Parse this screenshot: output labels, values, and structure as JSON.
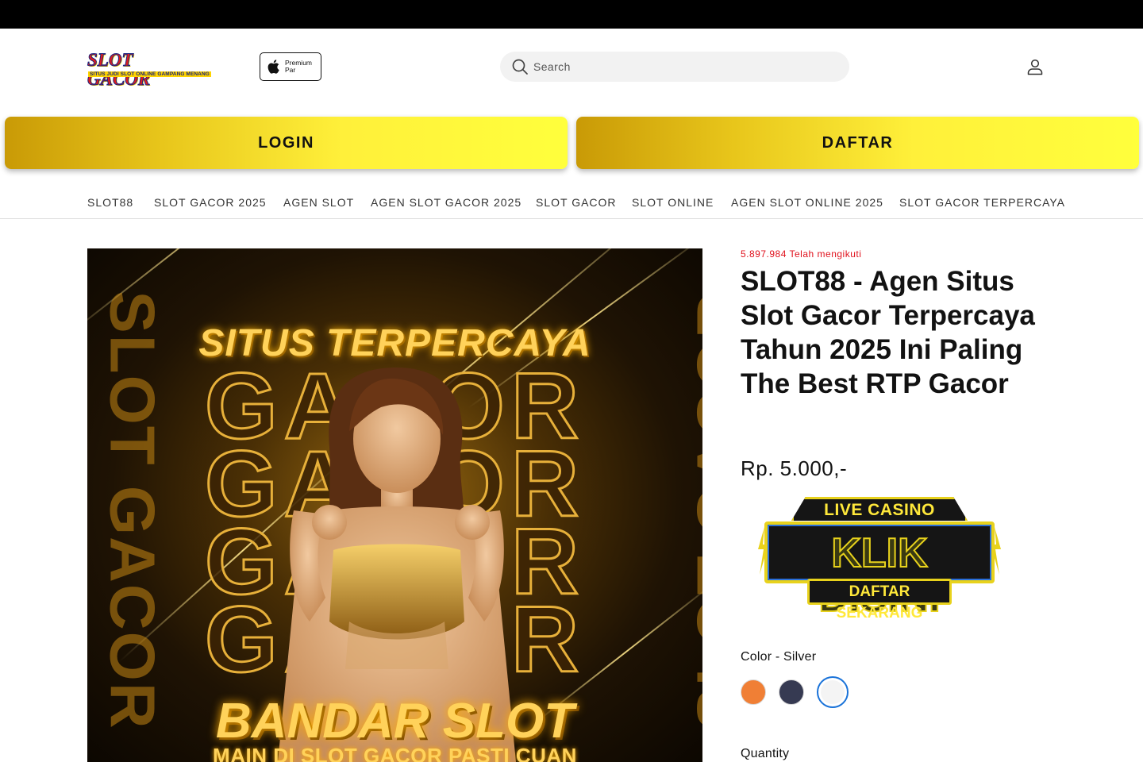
{
  "header": {
    "logo_main": "SLOT GACOR",
    "logo_sub": "SITUS JUDI SLOT ONLINE GAMPANG MENANG",
    "badge_line1": "Premium",
    "badge_line2": "Par",
    "search_placeholder": "Search",
    "icons": {
      "search": "search-icon",
      "account": "user-account-icon",
      "badge": "apple-icon"
    }
  },
  "cta": {
    "login_label": "LOGIN",
    "daftar_label": "DAFTAR",
    "gradient_colors": [
      "#c99a06",
      "#fff03a"
    ]
  },
  "nav": {
    "items": [
      "SLOT88",
      "SLOT GACOR 2025",
      "AGEN SLOT",
      "AGEN SLOT GACOR 2025",
      "SLOT GACOR",
      "SLOT ONLINE",
      "AGEN SLOT ONLINE 2025",
      "SLOT GACOR TERPERCAYA"
    ]
  },
  "hero": {
    "headline": "SITUS TERPERCAYA",
    "gacor_rows": [
      "GACOR",
      "GACOR",
      "GACOR",
      "GACOR"
    ],
    "side_text": "SLOT GACOR",
    "title_bottom": "BANDAR SLOT",
    "subtitle_bottom": "MAIN DI SLOT GACOR PASTI CUAN"
  },
  "product": {
    "followers": "5.897.984 Telah mengikuti",
    "title": "SLOT88 - Agen Situs Slot Gacor Terpercaya Tahun 2025 Ini Paling The Best RTP Gacor",
    "price": "Rp. 5.000,-",
    "promo": {
      "top": "LIVE CASINO",
      "middle": "KLIK DISINI",
      "bottom": "DAFTAR SEKARANG"
    },
    "color_label": "Color - Silver",
    "swatches": [
      {
        "name": "Orange",
        "hex": "#f07f35"
      },
      {
        "name": "Navy",
        "hex": "#363a52"
      },
      {
        "name": "Silver",
        "hex": "#f4f4f4",
        "selected": true
      }
    ],
    "quantity_label": "Quantity"
  },
  "colors": {
    "accent_red": "#e0121d",
    "selected_outline": "#1a73d9",
    "gold": "#ffd25a"
  }
}
